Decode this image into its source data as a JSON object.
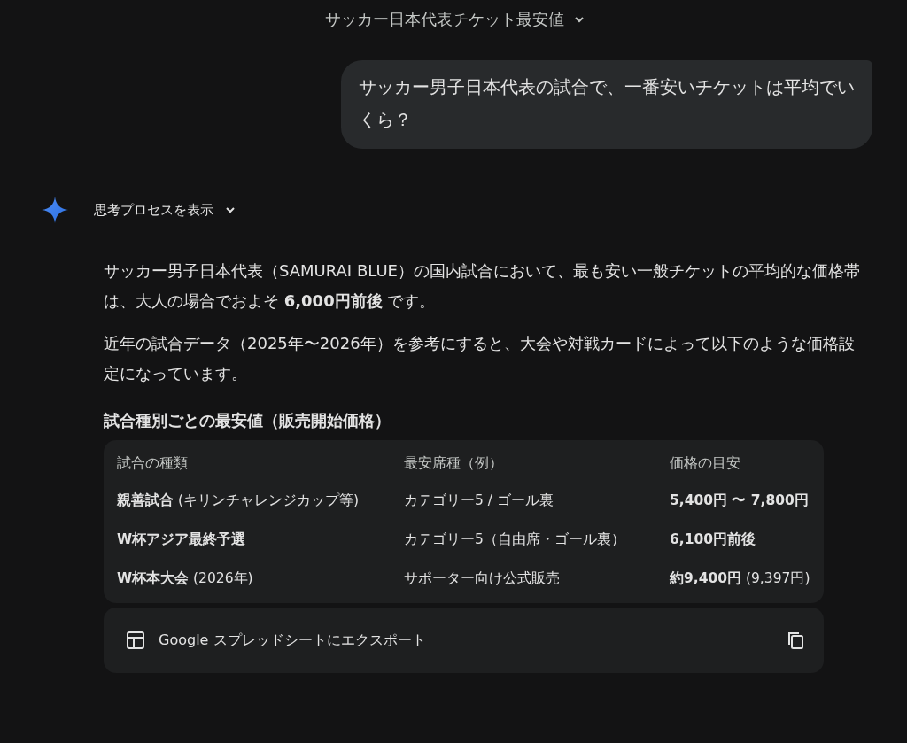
{
  "header": {
    "title": "サッカー日本代表チケット最安値"
  },
  "user_message": {
    "text": "サッカー男子日本代表の試合で、一番安いチケットは平均でいくら？"
  },
  "thinking_toggle": {
    "label": "思考プロセスを表示",
    "expanded": false
  },
  "response": {
    "paragraphs": [
      "サッカー男子日本代表（SAMURAI BLUE）の国内試合において、最も安い一般チケットの平均的な価格帯は、大人の場合でおよそ **6,000円前後** です。",
      "近年の試合データ（2025年〜2026年）を参考にすると、大会や対戦カードによって以下のような価格設定になっています。"
    ],
    "table_heading": "試合種別ごとの最安値（販売開始価格）",
    "table": {
      "columns": [
        "試合の種類",
        "最安席種（例）",
        "価格の目安"
      ],
      "rows": [
        [
          "**親善試合** (キリンチャレンジカップ等)",
          "カテゴリー5 / ゴール裏",
          "**5,400円 〜 7,800円**"
        ],
        [
          "**W杯アジア最終予選**",
          "カテゴリー5（自由席・ゴール裏）",
          "**6,100円前後**"
        ],
        [
          "**W杯本大会** (2026年)",
          "サポーター向け公式販売",
          "**約9,400円** (9,397円)"
        ]
      ]
    },
    "export": {
      "label": "Google スプレッドシートにエクスポート"
    }
  }
}
